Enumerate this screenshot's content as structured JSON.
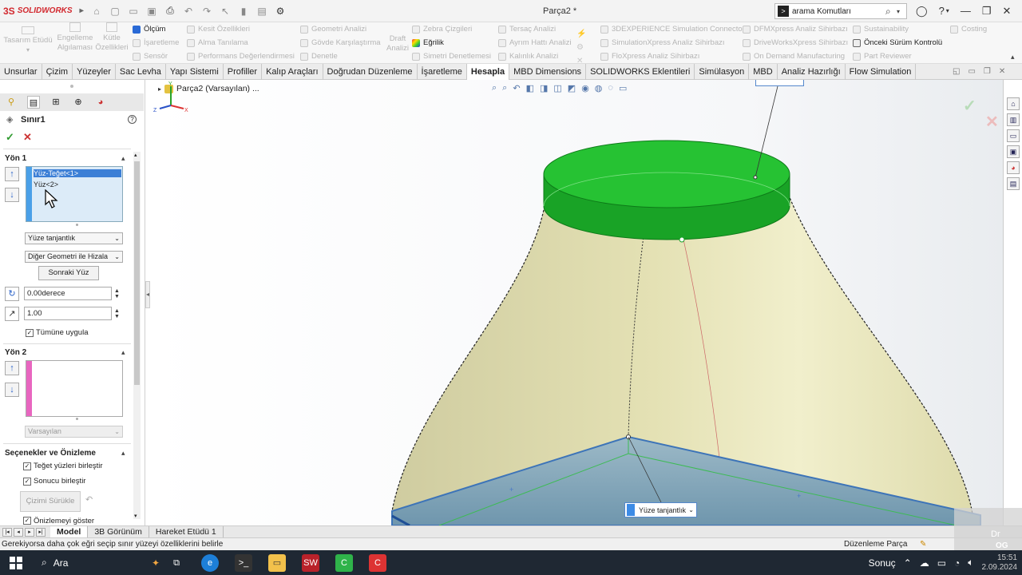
{
  "app": {
    "brand": "SOLIDWORKS",
    "brand_mark": "3S",
    "document_title": "Parça2 *",
    "search_placeholder": "arama Komutları",
    "search_prompt_icon": ">"
  },
  "ribbon": {
    "big_buttons": [
      {
        "label": "Tasarım Etüdü"
      },
      {
        "label": "Engelleme Algılaması"
      },
      {
        "label": "Kütle Özellikleri"
      },
      {
        "label": "Draft Analizi"
      }
    ],
    "col1": [
      "Ölçüm",
      "İşaretleme",
      "Sensör"
    ],
    "col2": [
      "Kesit Özellikleri",
      "Alma Tanılama",
      "Performans Değerlendirmesi"
    ],
    "col3": [
      "Geometri Analizi",
      "Gövde Karşılaştırma",
      "Denetle"
    ],
    "col4": [
      "Zebra Çizgileri",
      "Eğrilik",
      "Simetri Denetlemesi"
    ],
    "col5": [
      "Tersaç Analizi",
      "Ayrım Hattı Analizi",
      "Kalınlık Analizi"
    ],
    "col6": [
      "3DEXPERIENCE Simulation Connector",
      "SimulationXpress Analiz Sihirbazı",
      "FloXpress Analiz Sihirbazı"
    ],
    "col7": [
      "DFMXpress Analiz Sihirbazı",
      "DriveWorksXpress Sihirbazı",
      "On Demand Manufacturing"
    ],
    "col8": [
      "Sustainability",
      "Önceki Sürüm Kontrolü",
      "Part Reviewer"
    ],
    "col9": [
      "Costing"
    ]
  },
  "tabs": [
    "Unsurlar",
    "Çizim",
    "Yüzeyler",
    "Sac Levha",
    "Yapı Sistemi",
    "Profiller",
    "Kalıp Araçları",
    "Doğrudan Düzenleme",
    "İşaretleme",
    "Hesapla",
    "MBD Dimensions",
    "SOLIDWORKS Eklentileri",
    "Simülasyon",
    "MBD",
    "Analiz Hazırlığı",
    "Flow Simulation"
  ],
  "active_tab": "Hesapla",
  "property_manager": {
    "title": "Sınır1",
    "help": "?",
    "ok": "✓",
    "cancel": "✕",
    "dir1": {
      "heading": "Yön 1",
      "items": [
        "Yüz-Teğet<1>",
        "Yüz<2>"
      ],
      "tangency": "Yüze tanjantlık",
      "alignment": "Diğer Geometri ile Hizala",
      "next_face_button": "Sonraki Yüz",
      "angle": "0.00derece",
      "tangent_length": "1.00",
      "apply_all": "Tümüne uygula",
      "apply_all_checked": true
    },
    "dir2": {
      "heading": "Yön 2",
      "default_value": "Varsayılan"
    },
    "options": {
      "heading": "Seçenekler ve Önizleme",
      "merge_tangent": "Teğet yüzleri birleştir",
      "merge_result": "Sonucu birleştir",
      "drag_sketch": "Çizimi Sürükle",
      "show_preview": "Önizlemeyi göster"
    }
  },
  "viewport": {
    "tree_label": "Parça2 (Varsayılan) ...",
    "callout_label": "Yüze tanjantlık",
    "colors": {
      "cap": "#22b02a",
      "surface": "#e7e4b4",
      "block": "#7aa6c2"
    }
  },
  "bottom_tabs": [
    "Model",
    "3B Görünüm",
    "Hareket Etüdü 1"
  ],
  "active_bottom_tab": "Model",
  "status": {
    "message": "Gerekiyorsa daha çok eğri seçip sınır yüzeyi özelliklerini belirle",
    "mode": "Düzenleme Parça"
  },
  "watermark": {
    "line1": "Dr",
    "line2": "OG"
  },
  "taskbar": {
    "search": "Ara",
    "weather": "Sonuç",
    "time": "15:51",
    "date": "2.09.2024"
  }
}
